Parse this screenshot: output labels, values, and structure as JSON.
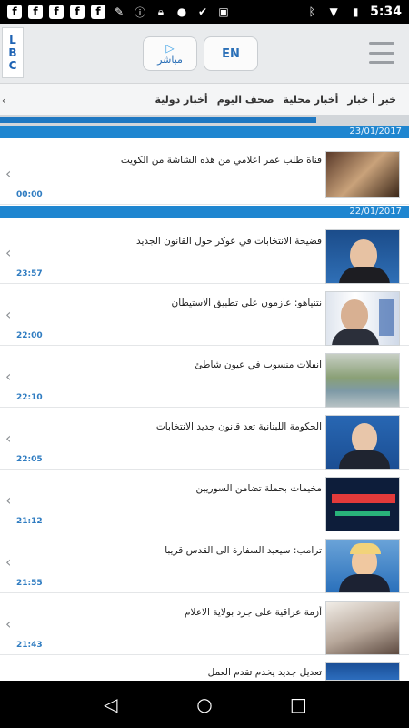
{
  "status": {
    "time": "5:34",
    "left_icons": [
      "facebook-icon",
      "facebook-icon",
      "facebook-icon",
      "facebook-icon",
      "facebook-icon",
      "tools-icon",
      "info-icon",
      "lock-icon",
      "shield-icon",
      "check-icon",
      "camera-icon"
    ],
    "right_icons": [
      "bluetooth-icon",
      "wifi-icon",
      "battery-icon"
    ]
  },
  "header": {
    "logo_letters": [
      "L",
      "B",
      "C"
    ],
    "live_label": "مباشر",
    "lang_label": "EN"
  },
  "tabs": [
    "خبر أ خبار",
    "أخبار محلية",
    "صحف اليوم",
    "أخبار دولية",
    "‹"
  ],
  "dates": [
    "23/01/2017",
    "22/01/2017"
  ],
  "news": [
    {
      "headline": "قناة طلب عمر اعلامي من هذه الشاشة من الكويت",
      "time": "00:00"
    },
    {
      "headline": "فضيحة الانتخابات في عوكر حول القانون الجديد",
      "time": "23:57"
    },
    {
      "headline": "نتنياهو: عازمون على تطبيق الاستيطان",
      "time": "22:00"
    },
    {
      "headline": "انفلات منسوب في عيون شاطئ",
      "time": "22:10"
    },
    {
      "headline": "الحكومة اللبنانية تعد قانون جديد الانتخابات",
      "time": "22:05"
    },
    {
      "headline": "مخيمات بحملة تضامن السوريين",
      "time": "21:12"
    },
    {
      "headline": "ترامب: سيعيد السفارة الى القدس قريبا",
      "time": "21:55"
    },
    {
      "headline": "أزمة عراقية على جرد بولاية الاعلام",
      "time": "21:43"
    },
    {
      "headline": "تعديل جديد يخدم تقدم العمل",
      "time": ""
    }
  ],
  "colors": {
    "accent": "#1f86d0",
    "time": "#2f7cc1"
  }
}
